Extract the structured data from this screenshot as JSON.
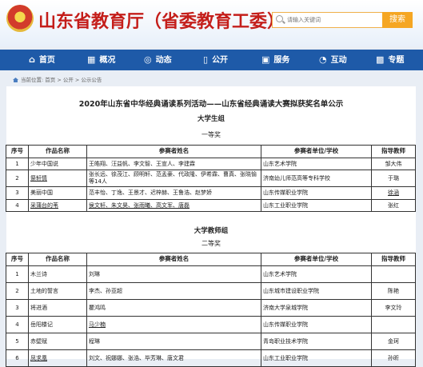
{
  "header": {
    "site_title": "山东省教育厅（省委教育工委）",
    "search_placeholder": "请输入关键词",
    "search_button": "搜索"
  },
  "nav": [
    {
      "icon": "home-icon",
      "glyph": "⌂",
      "label": "首页"
    },
    {
      "icon": "overview-icon",
      "glyph": "▦",
      "label": "概况"
    },
    {
      "icon": "news-icon",
      "glyph": "◎",
      "label": "动态"
    },
    {
      "icon": "book-icon",
      "glyph": "▯",
      "label": "公开"
    },
    {
      "icon": "service-icon",
      "glyph": "▣",
      "label": "服务"
    },
    {
      "icon": "chat-icon",
      "glyph": "◔",
      "label": "互动"
    },
    {
      "icon": "topic-icon",
      "glyph": "▩",
      "label": "专题"
    }
  ],
  "breadcrumb": "当前位置: 首页 > 公开 > 公示公告",
  "document": {
    "title": "2020年山东省中华经典诵读系列活动——山东省经典诵读大赛拟获奖名单公示",
    "sections": [
      {
        "group": "大学生组",
        "prize": "一等奖",
        "headers": [
          "序号",
          "作品名称",
          "参赛者姓名",
          "参赛者单位/学校",
          "指导教师"
        ],
        "rows": [
          {
            "num": "1",
            "title": "少年中国说",
            "names": "王皓翔、汪益帆、李文智、王宣人、李建霖",
            "unit": "山东艺术学院",
            "teacher": "邹大伟"
          },
          {
            "num": "2",
            "title": "祭轩情",
            "names": "张长远、徐茂江、顾明轩、范孟豪、代政隆、伊希霖、曹真、张晓愉等14人",
            "unit": "济南幼儿师范高等专科学校",
            "teacher": "于璐"
          },
          {
            "num": "3",
            "title": "美丽中国",
            "names": "范丰怡、丁逸、王景才、迟梓赫、王鲁浩、赵梦娇",
            "unit": "山东传媒职业学院",
            "teacher": "徐涵"
          },
          {
            "num": "4",
            "title": "采蒲台的苇",
            "names": "侯文轩、朱文昊、张雨曦、高文军、唐磊",
            "unit": "山东工业职业学院",
            "teacher": "张红"
          }
        ]
      },
      {
        "group": "大学教师组",
        "prize": "二等奖",
        "headers": [
          "序号",
          "作品名称",
          "参赛者姓名",
          "参赛者单位/学校",
          "指导教师"
        ],
        "rows": [
          {
            "num": "1",
            "title": "木兰诗",
            "names": "刘琳",
            "unit": "山东艺术学院",
            "teacher": ""
          },
          {
            "num": "2",
            "title": "土地的誓言",
            "names": "李杰、孙亚超",
            "unit": "山东城市建设职业学院",
            "teacher": "陈艳"
          },
          {
            "num": "3",
            "title": "将进酒",
            "names": "瞿鸿鸣",
            "unit": "济南大学泉城学院",
            "teacher": "李文玲"
          },
          {
            "num": "4",
            "title": "岳阳楼记",
            "names": "马少楠",
            "unit": "山东传媒职业学院",
            "teacher": ""
          },
          {
            "num": "5",
            "title": "赤壁赋",
            "names": "程琳",
            "unit": "青岛职业技术学院",
            "teacher": "金珂"
          },
          {
            "num": "6",
            "title": "凤求凰",
            "names": "刘文、祝娜娜、张浩、毕芳琳、唐文君",
            "unit": "山东工业职业学院",
            "teacher": "孙昕"
          }
        ]
      }
    ]
  }
}
